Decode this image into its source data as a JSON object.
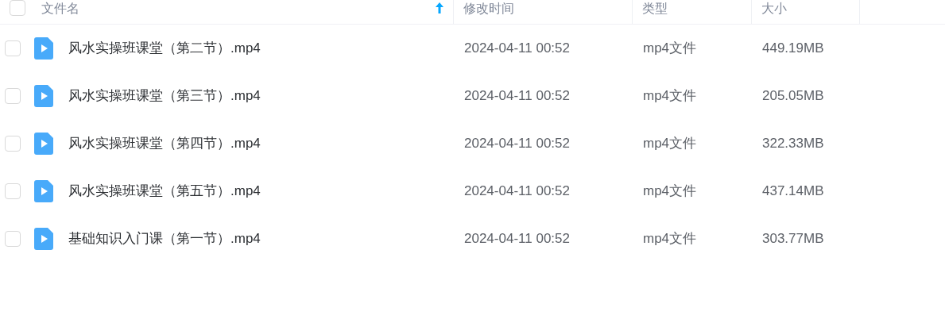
{
  "table": {
    "select_all": {
      "checked": false
    },
    "columns": [
      {
        "label": "文件名",
        "sorted": true
      },
      {
        "label": "修改时间",
        "sorted": false
      },
      {
        "label": "类型",
        "sorted": false
      },
      {
        "label": "大小",
        "sorted": false
      }
    ],
    "rows": [
      {
        "checked": false,
        "name": "风水实操班课堂（第二节）.mp4",
        "modified": "2024-04-11 00:52",
        "type": "mp4文件",
        "size": "449.19MB"
      },
      {
        "checked": false,
        "name": "风水实操班课堂（第三节）.mp4",
        "modified": "2024-04-11 00:52",
        "type": "mp4文件",
        "size": "205.05MB"
      },
      {
        "checked": false,
        "name": "风水实操班课堂（第四节）.mp4",
        "modified": "2024-04-11 00:52",
        "type": "mp4文件",
        "size": "322.33MB"
      },
      {
        "checked": false,
        "name": "风水实操班课堂（第五节）.mp4",
        "modified": "2024-04-11 00:52",
        "type": "mp4文件",
        "size": "437.14MB"
      },
      {
        "checked": false,
        "name": "基础知识入门课（第一节）.mp4",
        "modified": "2024-04-11 00:52",
        "type": "mp4文件",
        "size": "303.77MB"
      }
    ]
  }
}
